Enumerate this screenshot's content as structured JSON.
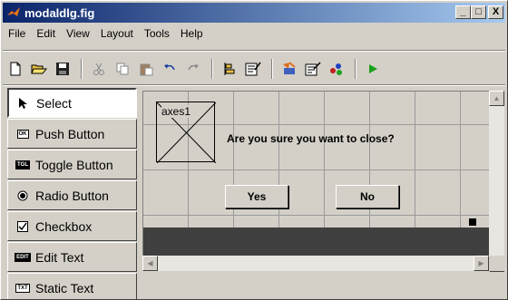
{
  "window": {
    "title": "modaldlg.fig"
  },
  "title_buttons": [
    "_",
    "□",
    "X"
  ],
  "menu": [
    "File",
    "Edit",
    "View",
    "Layout",
    "Tools",
    "Help"
  ],
  "toolbar_icons": [
    "new-icon",
    "open-icon",
    "save-icon",
    "cut-icon",
    "copy-icon",
    "paste-icon",
    "undo-icon",
    "redo-icon",
    "align-icon",
    "menu-editor-icon",
    "property-inspector-icon",
    "object-browser-icon",
    "mfile-editor-icon",
    "run-icon"
  ],
  "palette": [
    {
      "label": "Select",
      "tag": ""
    },
    {
      "label": "Push Button",
      "tag": "OK"
    },
    {
      "label": "Toggle Button",
      "tag": "TGL"
    },
    {
      "label": "Radio Button",
      "tag": ""
    },
    {
      "label": "Checkbox",
      "tag": ""
    },
    {
      "label": "Edit Text",
      "tag": "EDIT"
    },
    {
      "label": "Static Text",
      "tag": "TXT"
    }
  ],
  "figure": {
    "axes_label": "axes1",
    "prompt": "Are you sure you want to close?",
    "yes_label": "Yes",
    "no_label": "No"
  },
  "colors": {
    "titlebar_start": "#0a246a",
    "titlebar_end": "#a6caf0",
    "face": "#d4d0c8",
    "run": "#1aa01a"
  }
}
